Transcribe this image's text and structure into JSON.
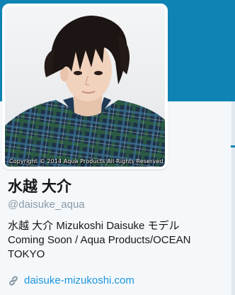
{
  "profile": {
    "display_name": "水越 大介",
    "handle": "@daisuke_aqua",
    "bio_lines": [
      "水越 大介 Mizukoshi Daisuke モデル",
      "Coming Soon / Aqua Products/OCEAN",
      "TOKYO"
    ],
    "website": "daisuke-mizukoshi.com",
    "avatar_caption": "Copyright © 2014 Aqua Products All Rights Reserved."
  },
  "icons": {
    "link": "link-icon"
  },
  "colors": {
    "banner": "#0f84b4",
    "background": "#f5f8fa",
    "name_text": "#14171a",
    "handle_text": "#8899a6",
    "link_text": "#1b95e0",
    "link_icon": "#8899a6"
  }
}
